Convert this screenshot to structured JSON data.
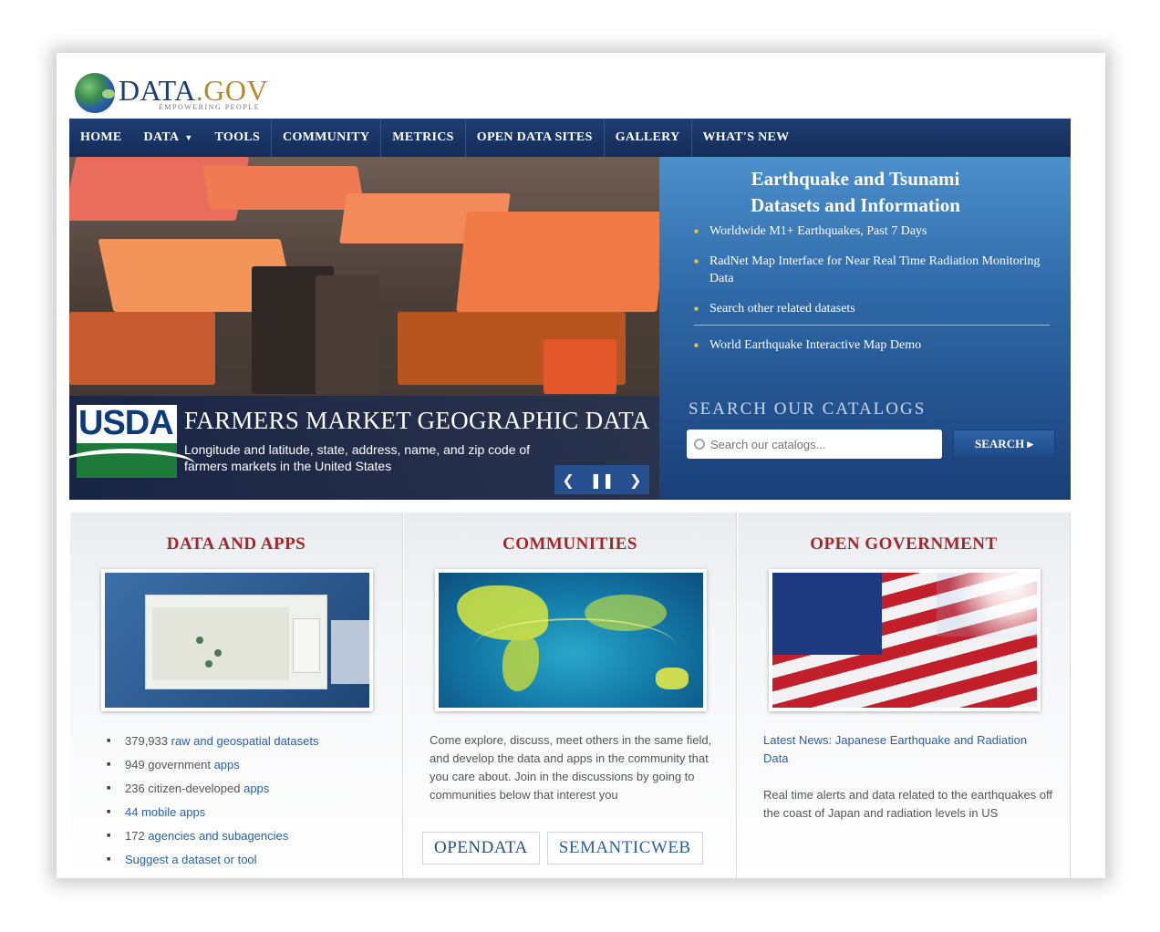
{
  "logo": {
    "text": "DATA",
    "suffix": ".GOV",
    "tagline": "EMPOWERING PEOPLE"
  },
  "nav": {
    "items": [
      "HOME",
      "DATA",
      "TOOLS",
      "COMMUNITY",
      "METRICS",
      "OPEN DATA SITES",
      "GALLERY",
      "WHAT'S NEW"
    ]
  },
  "hero": {
    "caption_title": "FARMERS MARKET GEOGRAPHIC DATA",
    "caption_sub": "Longitude and latitude, state, address, name, and zip code of farmers markets in the United States",
    "usda": "USDA",
    "controls": {
      "prev": "❮",
      "pause": "❚❚",
      "next": "❯"
    }
  },
  "panel": {
    "title_line1": "Earthquake and Tsunami",
    "title_line2": "Datasets and Information",
    "links": [
      "Worldwide M1+ Earthquakes, Past 7 Days",
      "RadNet Map Interface for Near Real Time Radiation Monitoring Data",
      "Search other related datasets",
      "World Earthquake Interactive Map Demo"
    ],
    "search_label": "SEARCH OUR CATALOGS",
    "search_placeholder": "Search our catalogs...",
    "search_button": "SEARCH ▸"
  },
  "columns": {
    "data_apps": {
      "title": "DATA AND APPS",
      "items": [
        {
          "prefix": "379,933 ",
          "link": "raw and geospatial datasets"
        },
        {
          "prefix": "949 government ",
          "link": "apps"
        },
        {
          "prefix": "236 citizen-developed ",
          "link": "apps"
        },
        {
          "prefix": "",
          "link": "44 mobile apps"
        },
        {
          "prefix": "172 ",
          "link": "agencies and subagencies"
        },
        {
          "prefix": "",
          "link": "Suggest a dataset or tool"
        }
      ]
    },
    "communities": {
      "title": "COMMUNITIES",
      "text": "Come explore, discuss, meet others in the same field, and develop the data and apps in the community that you care about. Join in the discussions by going to communities below that interest you",
      "badges": [
        "OPENDATA",
        "SEMANTICWEB"
      ]
    },
    "open_gov": {
      "title": "OPEN GOVERNMENT",
      "news": "Latest News: Japanese Earthquake and Radiation Data",
      "text": "Real time alerts and data related to the earthquakes off the coast of Japan and radiation levels in US"
    }
  },
  "colors": {
    "nav": "#1f3e72",
    "accent": "#a3262a",
    "link": "#2a5fa0"
  }
}
